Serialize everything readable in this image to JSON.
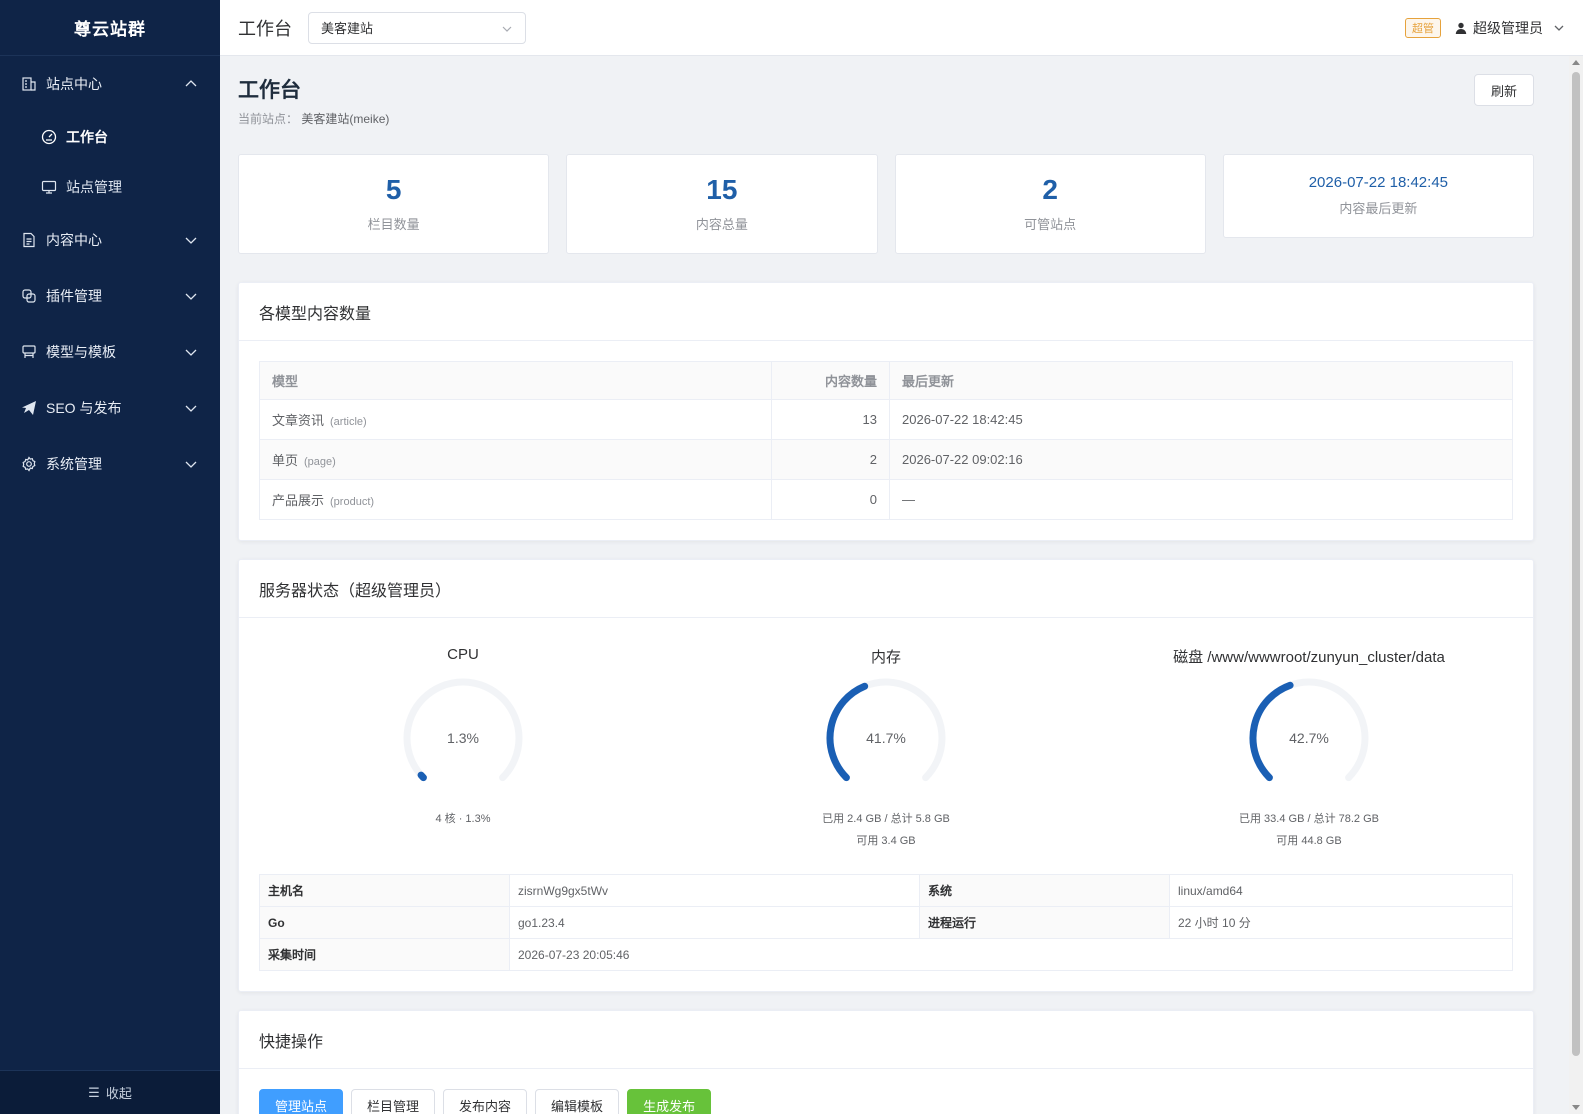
{
  "sidebar": {
    "brand": "尊云站群",
    "groups": [
      {
        "label": "站点中心",
        "icon": "building-icon",
        "expanded": true,
        "children": [
          {
            "label": "工作台",
            "icon": "dashboard-icon",
            "active": true
          },
          {
            "label": "站点管理",
            "icon": "monitor-icon",
            "active": false
          }
        ]
      },
      {
        "label": "内容中心",
        "icon": "document-icon",
        "expanded": false
      },
      {
        "label": "插件管理",
        "icon": "plugin-icon",
        "expanded": false
      },
      {
        "label": "模型与模板",
        "icon": "template-icon",
        "expanded": false
      },
      {
        "label": "SEO 与发布",
        "icon": "send-icon",
        "expanded": false
      },
      {
        "label": "系统管理",
        "icon": "gear-icon",
        "expanded": false
      }
    ],
    "collapse_label": "收起"
  },
  "header": {
    "title": "工作台",
    "site_select_value": "美客建站",
    "badge": "超管",
    "user": "超级管理员"
  },
  "page": {
    "title": "工作台",
    "current_site_label": "当前站点：",
    "current_site_value": "美客建站(meike)",
    "refresh_label": "刷新"
  },
  "stats": [
    {
      "value": "5",
      "label": "栏目数量"
    },
    {
      "value": "15",
      "label": "内容总量"
    },
    {
      "value": "2",
      "label": "可管站点"
    },
    {
      "value": "2026-07-22 18:42:45",
      "label": "内容最后更新"
    }
  ],
  "models_card": {
    "title": "各模型内容数量",
    "headers": [
      "模型",
      "内容数量",
      "最后更新"
    ],
    "rows": [
      {
        "name": "文章资讯",
        "code": "(article)",
        "count": "13",
        "updated": "2026-07-22 18:42:45"
      },
      {
        "name": "单页",
        "code": "(page)",
        "count": "2",
        "updated": "2026-07-22 09:02:16"
      },
      {
        "name": "产品展示",
        "code": "(product)",
        "count": "0",
        "updated": "—"
      }
    ]
  },
  "server_card": {
    "title": "服务器状态（超级管理员）",
    "gauges": [
      {
        "title": "CPU",
        "percent": 1.3,
        "percent_label": "1.3%",
        "lines": [
          "4 核 · 1.3%"
        ]
      },
      {
        "title": "内存",
        "percent": 41.7,
        "percent_label": "41.7%",
        "lines": [
          "已用 2.4 GB / 总计 5.8 GB",
          "可用 3.4 GB"
        ]
      },
      {
        "title": "磁盘 /www/wwwroot/zunyun_cluster/data",
        "percent": 42.7,
        "percent_label": "42.7%",
        "lines": [
          "已用 33.4 GB / 总计 78.2 GB",
          "可用 44.8 GB"
        ]
      }
    ],
    "gauge_color": "#1a5fb4",
    "gauge_track": "#f2f4f7",
    "info": {
      "hostname_k": "主机名",
      "hostname_v": "zisrnWg9gx5tWv",
      "os_k": "系统",
      "os_v": "linux/amd64",
      "go_k": "Go",
      "go_v": "go1.23.4",
      "uptime_k": "进程运行",
      "uptime_v": "22 小时 10 分",
      "time_k": "采集时间",
      "time_v": "2026-07-23 20:05:46"
    }
  },
  "quick_card": {
    "title": "快捷操作",
    "buttons": [
      "管理站点",
      "栏目管理",
      "发布内容",
      "编辑模板",
      "生成发布"
    ]
  }
}
